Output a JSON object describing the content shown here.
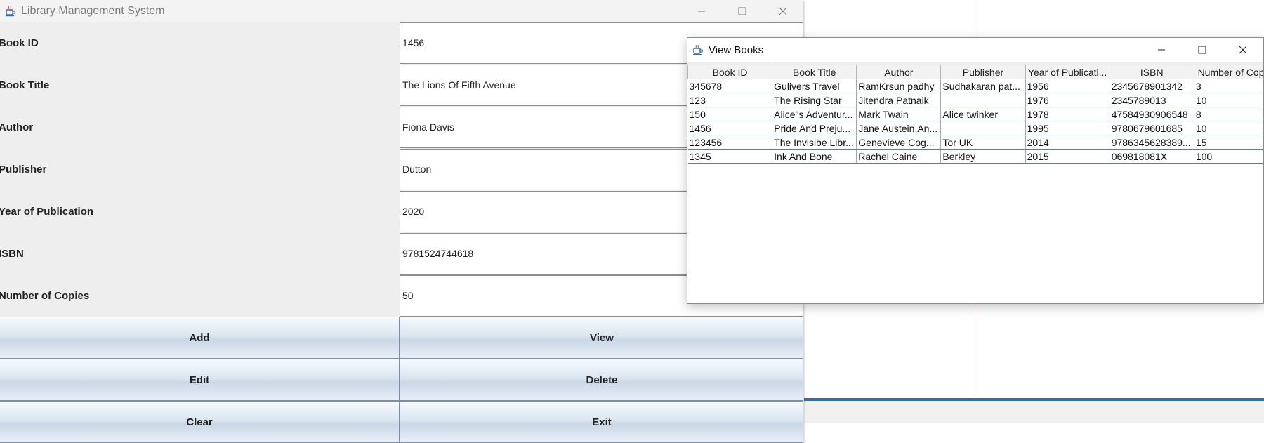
{
  "main_window": {
    "title": "Library Management System",
    "fields": [
      {
        "label": "Book ID",
        "value": "1456"
      },
      {
        "label": "Book Title",
        "value": "The Lions Of Fifth Avenue"
      },
      {
        "label": "Author",
        "value": "Fiona Davis"
      },
      {
        "label": "Publisher",
        "value": "Dutton"
      },
      {
        "label": "Year of Publication",
        "value": "2020"
      },
      {
        "label": "ISBN",
        "value": "9781524744618"
      },
      {
        "label": "Number of Copies",
        "value": "50"
      }
    ],
    "buttons": {
      "add": "Add",
      "view": "View",
      "edit": "Edit",
      "delete": "Delete",
      "clear": "Clear",
      "exit": "Exit"
    }
  },
  "view_window": {
    "title": "View Books",
    "columns": [
      "Book ID",
      "Book Title",
      "Author",
      "Publisher",
      "Year of Publicati...",
      "ISBN",
      "Number of Copi..."
    ],
    "rows": [
      [
        "345678",
        " Gulivers Travel",
        "RamKrsun padhy",
        "Sudhakaran pat...",
        "1956",
        "2345678901342",
        "3"
      ],
      [
        "123",
        "The Rising Star",
        "Jitendra Patnaik",
        "",
        "1976",
        "2345789013",
        "10"
      ],
      [
        "150",
        "Alice\"s Adventur...",
        "Mark Twain",
        "Alice twinker",
        "1978",
        "47584930906548",
        "8"
      ],
      [
        "1456",
        "Pride And Preju...",
        "Jane Austein,An...",
        "",
        "1995",
        "9780679601685",
        "10"
      ],
      [
        "123456",
        "The Invisibe Libr...",
        "Genevieve  Cog...",
        "Tor UK",
        "2014",
        "9786345628389...",
        "15"
      ],
      [
        "1345",
        "Ink And Bone",
        "Rachel Caine",
        "Berkley",
        "2015",
        "069818081X",
        "100"
      ]
    ]
  },
  "icons": {
    "app": "java-cup-icon",
    "minimize": "minimize-icon",
    "maximize": "maximize-icon",
    "close": "close-icon"
  },
  "colors": {
    "button_border": "#7a8ea8",
    "table_grid": "#5d7ba6",
    "ide_accent": "#2f6fad"
  }
}
